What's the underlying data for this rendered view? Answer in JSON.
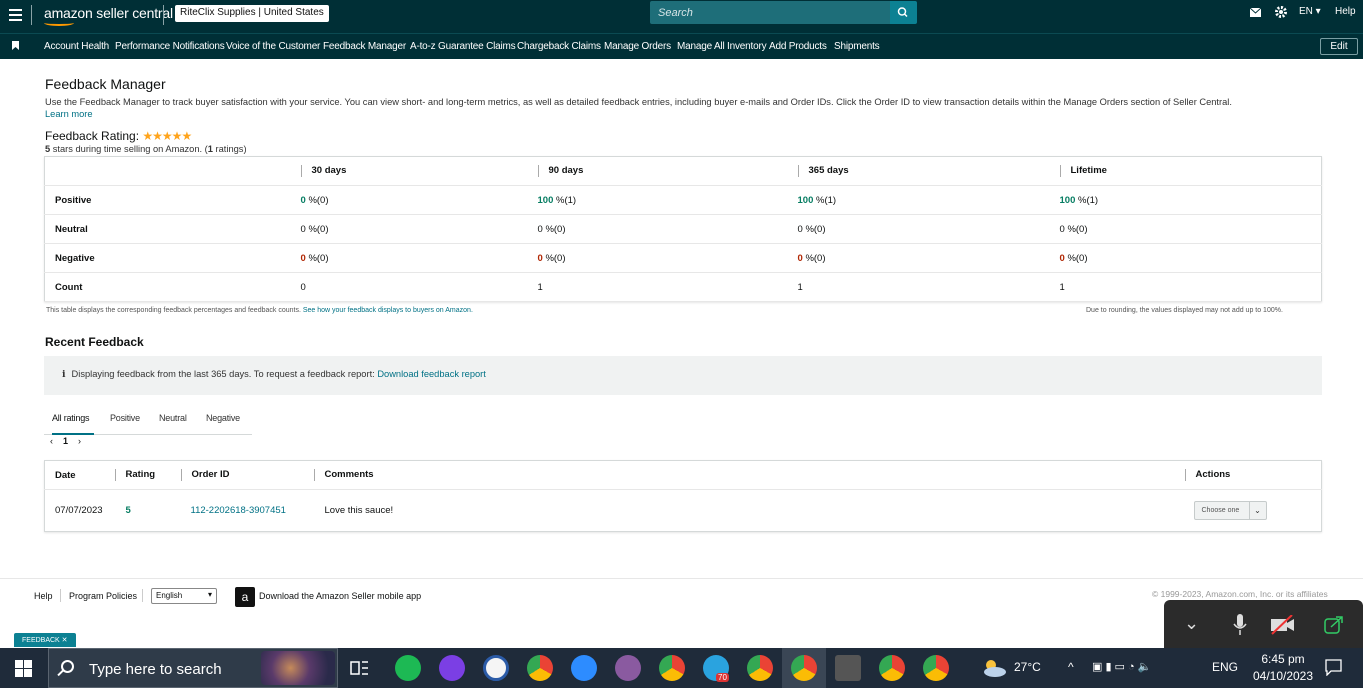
{
  "header": {
    "logo_text": "amazon seller central",
    "store": "RiteClix Supplies | United States",
    "search_placeholder": "Search",
    "language": "EN ▾",
    "help": "Help"
  },
  "nav": {
    "items": [
      "Account Health",
      "Performance Notifications",
      "Voice of the Customer",
      "Feedback Manager",
      "A-to-z Guarantee Claims",
      "Chargeback Claims",
      "Manage Orders",
      "Manage All Inventory",
      "Add Products",
      "Shipments"
    ],
    "edit": "Edit"
  },
  "page": {
    "title": "Feedback Manager",
    "intro": "Use the Feedback Manager to track buyer satisfaction with your service. You can view short- and long-term metrics, as well as detailed feedback entries, including buyer e-mails and Order IDs. Click the Order ID to view transaction details within the Manage Orders section of Seller Central.",
    "learn_more": "Learn more",
    "rating_label": "Feedback Rating:",
    "stars": "★★★★★",
    "rating_sub_prefix": "5",
    "rating_sub_mid": " stars during time selling on Amazon. (",
    "rating_sub_count": "1",
    "rating_sub_suffix": " ratings)"
  },
  "summary_table": {
    "headers": [
      "30 days",
      "90 days",
      "365 days",
      "Lifetime"
    ],
    "rows": [
      {
        "label": "Positive",
        "cells": [
          {
            "n": "0",
            "s": "%(0)"
          },
          {
            "n": "100",
            "s": "%(1)"
          },
          {
            "n": "100",
            "s": "%(1)"
          },
          {
            "n": "100",
            "s": "%(1)"
          }
        ]
      },
      {
        "label": "Neutral",
        "cells": [
          {
            "n": "0",
            "s": "%(0)"
          },
          {
            "n": "0",
            "s": "%(0)"
          },
          {
            "n": "0",
            "s": "%(0)"
          },
          {
            "n": "0",
            "s": "%(0)"
          }
        ]
      },
      {
        "label": "Negative",
        "cells": [
          {
            "n": "0",
            "s": "%(0)"
          },
          {
            "n": "0",
            "s": "%(0)"
          },
          {
            "n": "0",
            "s": "%(0)"
          },
          {
            "n": "0",
            "s": "%(0)"
          }
        ]
      },
      {
        "label": "Count",
        "cells": [
          {
            "n": "",
            "s": "0"
          },
          {
            "n": "",
            "s": "1"
          },
          {
            "n": "",
            "s": "1"
          },
          {
            "n": "",
            "s": "1"
          }
        ]
      }
    ],
    "note_left": "This table displays the corresponding feedback percentages and feedback counts.",
    "note_link": "See how your feedback displays to buyers on Amazon.",
    "note_right": "Due to rounding, the values displayed may not add up to 100%."
  },
  "recent": {
    "title": "Recent Feedback",
    "info_text": "Displaying feedback from the last 365 days. To request a feedback report:",
    "info_link": "Download feedback report",
    "tabs": [
      "All ratings",
      "Positive",
      "Neutral",
      "Negative"
    ],
    "page": "1",
    "columns": [
      "Date",
      "Rating",
      "Order ID",
      "Comments",
      "Actions"
    ],
    "row": {
      "date": "07/07/2023",
      "rating": "5",
      "order_id": "112-2202618-3907451",
      "comment": "Love this sauce!",
      "action": "Choose one"
    }
  },
  "footer": {
    "help": "Help",
    "policies": "Program Policies",
    "language": "English",
    "app": "Download the Amazon Seller mobile app",
    "copyright": "© 1999-2023, Amazon.com, Inc. or its affiliates",
    "feedback_tag": "FEEDBACK ✕"
  },
  "taskbar": {
    "search_text": "Type here to search",
    "temperature": "27°C",
    "lang": "ENG",
    "time": "6:45 pm",
    "date": "04/10/2023",
    "badge": "70"
  }
}
